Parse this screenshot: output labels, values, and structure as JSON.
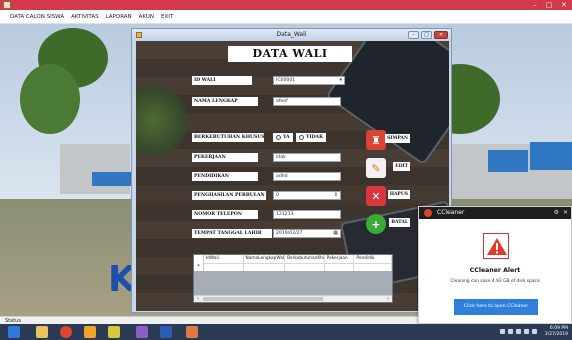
{
  "menubar": {
    "items": [
      "DATA CALON SISWA",
      "AKTIVITAS",
      "LAPORAN",
      "AKUN",
      "EXIT"
    ]
  },
  "main_window": {
    "window_controls": [
      "–",
      "□",
      "✕"
    ],
    "status_text": "Status"
  },
  "form_window": {
    "title": "Data_Wali",
    "window_controls": [
      "–",
      "□",
      "✕"
    ],
    "heading": "DATA WALI",
    "labels": {
      "id_wali": "ID WALI",
      "nama_lengkap": "NAMA LENGKAP",
      "berkebutuhan": "BERKEBUTUHAN KHUSUS",
      "pekerjaan": "PEKERJAAN",
      "pendidikan": "PENDIDIKAN",
      "penghasilan": "PENGHASILAN PERBULAN",
      "telepon": "NOMOR TELEPON",
      "tempat_tanggal": "TEMPAT TANGGAL LAHIR"
    },
    "values": {
      "id_wali": "IC00001",
      "nama_lengkap": "afeef",
      "pekerjaan": "ldak",
      "pendidikan": "adhd",
      "penghasilan": "0",
      "telepon": "121213",
      "tanggal": "2019/02/27"
    },
    "radio": {
      "ya": "YA",
      "tidak": "TIDAK"
    },
    "actions": {
      "simpan": "SIMPAN",
      "edit": "EDIT",
      "hapus": "HAPUS",
      "batal": "BATAL"
    },
    "grid": {
      "columns": [
        "IdWali",
        "NamaLengkapWali",
        "BerkebutuhanKhus",
        "Pekerjaan",
        "Pendidik"
      ],
      "new_row_marker": "*",
      "scroll_left": "‹",
      "scroll_right": "›"
    },
    "background_letter": "K"
  },
  "toast": {
    "app_name": "CCleaner",
    "gear": "⚙",
    "close": "✕",
    "title": "CCleaner Alert",
    "message": "Cleaning can save 4.93 GB of disk space",
    "cta": "Click here to open CCleaner"
  },
  "taskbar": {
    "time": "6:09 PM",
    "date": "2/27/2019"
  },
  "colors": {
    "main_titlebar": "#d2394b",
    "simpan": "#d84333",
    "edit": "#f2f2f2",
    "hapus": "#d8363e",
    "batal": "#3aaa3a",
    "cta": "#2f7fdc"
  }
}
